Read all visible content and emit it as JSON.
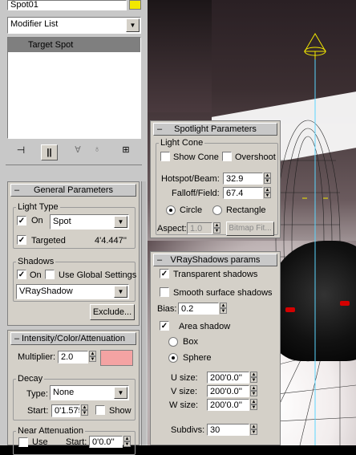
{
  "object_name": "Spot01",
  "modifier_list": "Modifier List",
  "stack_item": "Target Spot",
  "general": {
    "title": "General Parameters",
    "light_type_label": "Light Type",
    "on_label": "On",
    "type_value": "Spot",
    "targeted_label": "Targeted",
    "target_distance": "4'4.447''",
    "shadows_label": "Shadows",
    "shadows_on_label": "On",
    "use_global_label": "Use Global Settings",
    "shadow_type": "VRayShadow",
    "exclude_label": "Exclude..."
  },
  "intensity": {
    "title": "Intensity/Color/Attenuation",
    "multiplier_label": "Multiplier:",
    "multiplier_value": "2.0",
    "color": "#f4a3a3",
    "decay_label": "Decay",
    "type_label": "Type:",
    "type_value": "None",
    "start_label": "Start:",
    "start_value": "0'1.575",
    "show_label": "Show",
    "near_label": "Near Attenuation",
    "use_label": "Use",
    "near_start_label": "Start:",
    "near_start_value": "0'0.0''"
  },
  "spotlight": {
    "title": "Spotlight Parameters",
    "light_cone_label": "Light Cone",
    "show_cone_label": "Show Cone",
    "overshoot_label": "Overshoot",
    "hotspot_label": "Hotspot/Beam:",
    "hotspot_value": "32.9",
    "falloff_label": "Falloff/Field:",
    "falloff_value": "67.4",
    "circle_label": "Circle",
    "rectangle_label": "Rectangle",
    "aspect_label": "Aspect:",
    "aspect_value": "1.0",
    "bitmap_fit_label": "Bitmap Fit..."
  },
  "vray": {
    "title": "VRayShadows params",
    "transparent_label": "Transparent shadows",
    "smooth_label": "Smooth surface shadows",
    "bias_label": "Bias:",
    "bias_value": "0.2",
    "area_label": "Area shadow",
    "box_label": "Box",
    "sphere_label": "Sphere",
    "usize_label": "U size:",
    "usize_value": "200'0.0''",
    "vsize_label": "V size:",
    "vsize_value": "200'0.0''",
    "wsize_label": "W size:",
    "wsize_value": "200'0.0''",
    "subdivs_label": "Subdivs:",
    "subdivs_value": "30"
  },
  "colors": {
    "object_color": "#f2e800",
    "panel_bg": "#d4d0c8",
    "selection": "#7f7f7f",
    "light_gizmo": "#f2e800",
    "target_line": "#5ad6ff"
  }
}
